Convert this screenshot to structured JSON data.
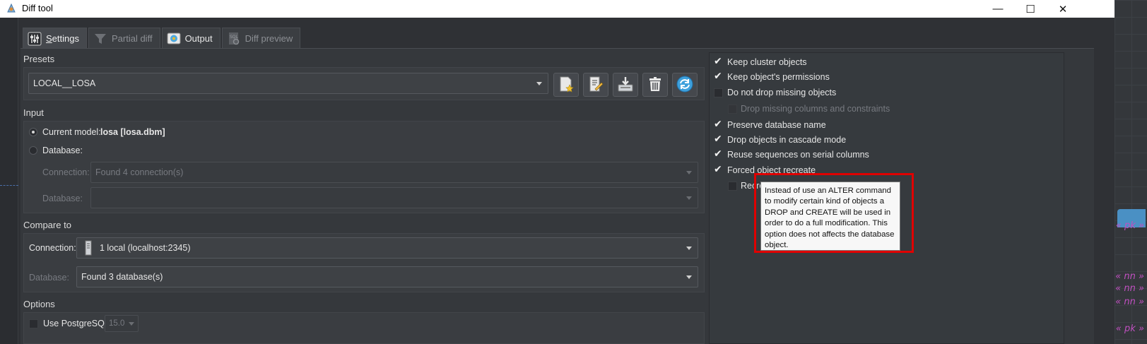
{
  "window": {
    "title": "Diff tool",
    "minimize": "—",
    "maximize": "☐",
    "close": "✕"
  },
  "tabs": [
    {
      "label": "Settings",
      "icon": "settings-sliders-icon",
      "active": true
    },
    {
      "label": "Partial diff",
      "icon": "funnel-icon",
      "active": false
    },
    {
      "label": "Output",
      "icon": "output-icon",
      "active": false
    },
    {
      "label": "Diff preview",
      "icon": "sql-preview-icon",
      "active": false
    }
  ],
  "presets": {
    "label": "Presets",
    "selected": "LOCAL__LOSA",
    "buttons": [
      "new-preset-icon",
      "edit-preset-icon",
      "save-preset-icon",
      "delete-preset-icon",
      "reload-preset-icon"
    ]
  },
  "input": {
    "label": "Input",
    "current_model_label": "Current model:",
    "current_model_value": "losa [losa.dbm]",
    "database_option": "Database:",
    "connection_label": "Connection:",
    "connection_value": "Found 4 connection(s)",
    "database_label": "Database:",
    "database_value": ""
  },
  "compare_to": {
    "label": "Compare to",
    "connection_label": "Connection:",
    "connection_value": "1 local (localhost:2345)",
    "database_label": "Database:",
    "database_value": "Found 3 database(s)"
  },
  "options": {
    "label": "Options",
    "use_postgres_label": "Use PostgreSQL:",
    "postgres_version": "15.0"
  },
  "right_options": [
    {
      "label": "Keep cluster objects",
      "checked": true,
      "disabled": false
    },
    {
      "label": "Keep object's permissions",
      "checked": true,
      "disabled": false
    },
    {
      "label": "Do not drop missing objects",
      "checked": false,
      "disabled": false
    },
    {
      "label": "Drop missing columns and constraints",
      "checked": false,
      "disabled": true
    },
    {
      "label": "Preserve database name",
      "checked": true,
      "disabled": false
    },
    {
      "label": "Drop objects in cascade mode",
      "checked": true,
      "disabled": false
    },
    {
      "label": "Reuse sequences on serial columns",
      "checked": true,
      "disabled": false
    },
    {
      "label": "Forced object recreate",
      "checked": true,
      "disabled": false
    },
    {
      "label": "Recre",
      "checked": false,
      "disabled": false
    }
  ],
  "tooltip": {
    "lines": [
      "Instead of use an ALTER command",
      "to modify certain kind of objects a",
      "DROP and CREATE will be used in",
      "order to do a full modification. This",
      "option does not affects the database",
      "object."
    ]
  },
  "background": {
    "tags": [
      "« pk »",
      "« nn »",
      "« nn »",
      "« nn »",
      "« pk »"
    ]
  }
}
